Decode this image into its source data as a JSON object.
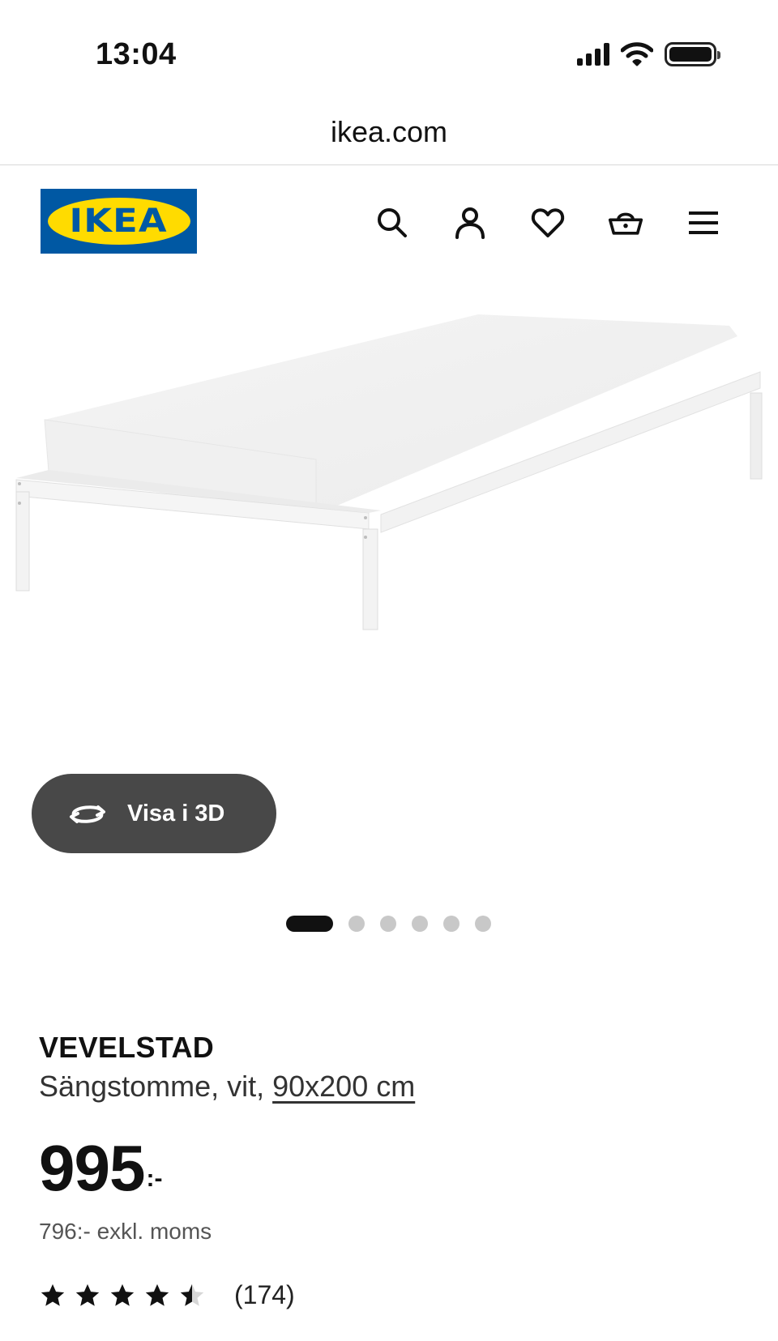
{
  "status_bar": {
    "time": "13:04"
  },
  "browser": {
    "url": "ikea.com"
  },
  "header": {
    "logo_text": "IKEA",
    "brand_colors": {
      "blue": "#0058a3",
      "yellow": "#ffdb00"
    },
    "icons": [
      "search-icon",
      "account-icon",
      "heart-icon",
      "basket-icon",
      "menu-icon"
    ]
  },
  "gallery": {
    "view_3d_label": "Visa i 3D",
    "total_images": 6,
    "active_index": 0
  },
  "product": {
    "name": "VEVELSTAD",
    "description_prefix": "Sängstomme, vit, ",
    "size_link": "90x200 cm",
    "price": "995",
    "price_suffix": ":-",
    "price_excl_vat": "796:- exkl. moms",
    "rating_value": 4.5,
    "rating_max": 5,
    "rating_count": "(174)"
  }
}
